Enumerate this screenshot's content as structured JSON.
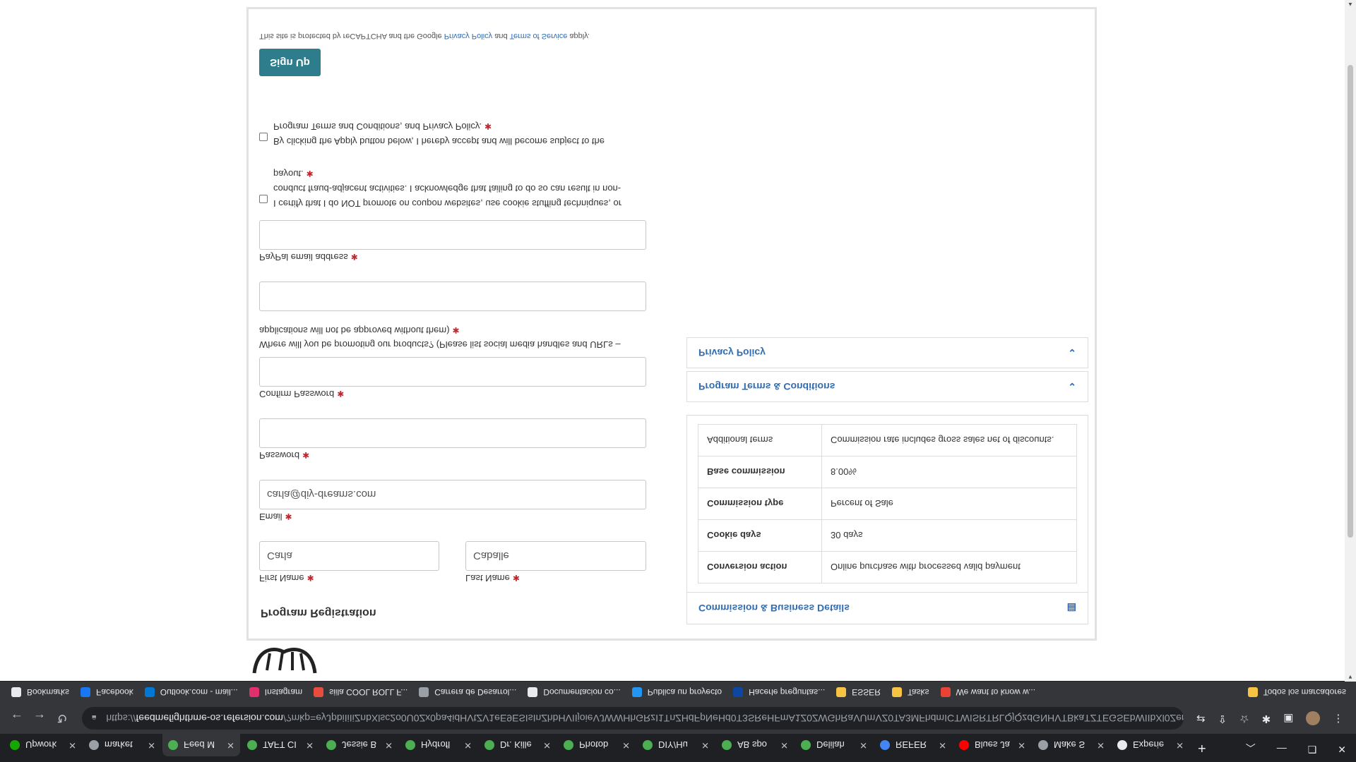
{
  "browser": {
    "tabs": [
      {
        "label": "Upwork",
        "color": "#14a800",
        "active": false
      },
      {
        "label": "market",
        "color": "#9aa0a6",
        "active": false
      },
      {
        "label": "Feed M",
        "color": "#4caf50",
        "active": true
      },
      {
        "label": "TAFT CI",
        "color": "#4caf50",
        "active": false
      },
      {
        "label": "Jessie B",
        "color": "#4caf50",
        "active": false
      },
      {
        "label": "Hydrofl",
        "color": "#4caf50",
        "active": false
      },
      {
        "label": "Dr. Kille",
        "color": "#4caf50",
        "active": false
      },
      {
        "label": "Photob",
        "color": "#4caf50",
        "active": false
      },
      {
        "label": "DIY/Hu",
        "color": "#4caf50",
        "active": false
      },
      {
        "label": "AB spo",
        "color": "#4caf50",
        "active": false
      },
      {
        "label": "Delilah",
        "color": "#4caf50",
        "active": false
      },
      {
        "label": "REFER",
        "color": "#4285f4",
        "active": false
      },
      {
        "label": "Blues Ja",
        "color": "#ff0000",
        "active": false
      },
      {
        "label": "Make S",
        "color": "#9aa0a6",
        "active": false
      },
      {
        "label": "Experie",
        "color": "#e8eaed",
        "active": false
      }
    ],
    "new_tab_symbol": "+",
    "url_prefix": "https://",
    "url_host": "feedmefighthme-os.refersion.com",
    "url_rest": "/?mkp=eyJpbiIiIiZnbXlsc2o0U0Zx0pa4idHVtZV1eE9ESIsInZhbHVIIjoieVJWWHhGRzI1TnZHdFpNeHd0T3SReHFmA1Z0ZWGhRaVUmVZ0TA3MFhdmICTWISRTRLQjQzdGNHVTBkaTZTEGSEbWIIbXl0Zem...",
    "bookmarks": [
      {
        "label": "Bookmarks",
        "color": "#e8eaed"
      },
      {
        "label": "Facebook",
        "color": "#1877f2"
      },
      {
        "label": "Outlook.com - mail...",
        "color": "#0078d4"
      },
      {
        "label": "Instagram",
        "color": "#e1306c"
      },
      {
        "label": "siila COOL ROLL F...",
        "color": "#e74c3c"
      },
      {
        "label": "Carrera de Desarrol...",
        "color": "#9aa0a6"
      },
      {
        "label": "Documentacion co...",
        "color": "#e8eaed"
      },
      {
        "label": "Publica un proyecto",
        "color": "#2196f3"
      },
      {
        "label": "Hacerle preguntas...",
        "color": "#0d47a1"
      },
      {
        "label": "ESSER",
        "color": "#f6c343"
      },
      {
        "label": "Tasks",
        "color": "#f6c343"
      },
      {
        "label": "We want to know w...",
        "color": "#ea4335"
      }
    ],
    "bookmarks_right": "Todos los marcadores"
  },
  "form": {
    "title": "Program Registration",
    "first_name_label": "First Name",
    "first_name_value": "Carla",
    "last_name_label": "Last Name",
    "last_name_value": "Caballe",
    "email_label": "Email",
    "email_value": "carla@diy-dreams.com",
    "password_label": "Password",
    "confirm_password_label": "Confirm Password",
    "promote_label_line1": "Where will you be promoting our products? (Please list social media handles and URLs –",
    "promote_label_line2": "applications will not be approved without them)",
    "paypal_label": "PayPal email address",
    "certify_line1": "I certify that I do NOT promote on coupon websites, use cookie stuffing techniques, or",
    "certify_line2": "conduct fraud-adjacent activities. I acknowledge that failing to do so can result in non-",
    "certify_line3": "payout.",
    "terms_line1": "By clicking the Apply button below, I hereby accept and will become subject to the",
    "terms_line2": "Program Terms and Conditions, and Privacy Policy.",
    "required_mark": "✱",
    "signup_label": "Sign Up",
    "legal_prefix": "This site is protected by reCAPTCHA and the Google",
    "legal_privacy": "Privacy Policy",
    "legal_and": "and",
    "legal_terms": "Terms of Service",
    "legal_suffix": "apply."
  },
  "panel": {
    "title": "Commission & Business Details",
    "rows": [
      {
        "key": "Conversion action",
        "value": "Online purchase with processed valid payment"
      },
      {
        "key": "Cookie days",
        "value": "30 days"
      },
      {
        "key": "Commission type",
        "value": "Percent of Sale"
      },
      {
        "key": "Base commission",
        "value": "8.00%"
      },
      {
        "key": "Additional terms",
        "value": "Commission rate includes gross sales net of discounts."
      }
    ],
    "acc_terms": "Program Terms & Conditions",
    "acc_privacy": "Privacy Policy"
  },
  "colors": {
    "accent": "#2e7d8c",
    "link": "#2f6db5",
    "required": "#c0262d"
  }
}
